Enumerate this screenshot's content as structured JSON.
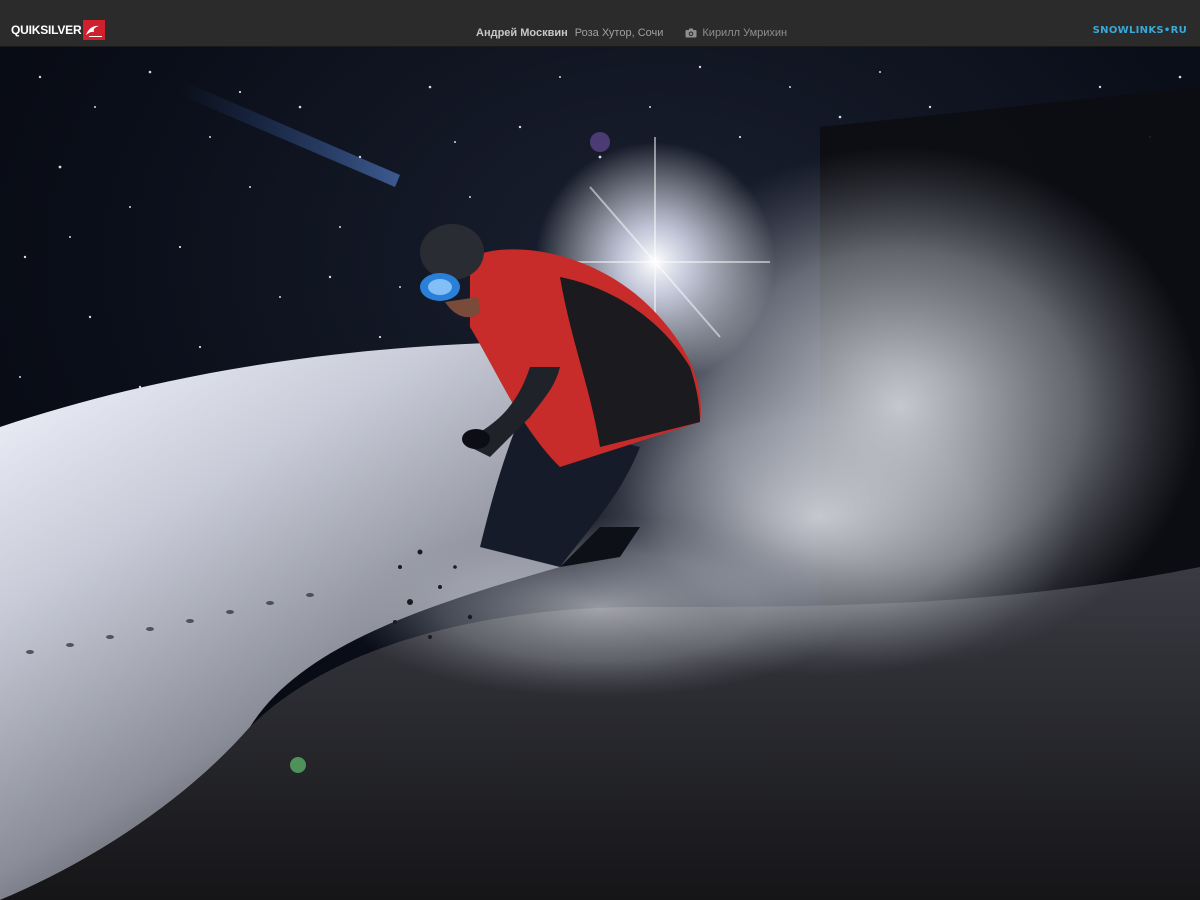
{
  "header": {
    "brand": "QUIKSILVER",
    "author": "Андрей Москвин",
    "location": "Роза Хутор, Сочи",
    "photographer": "Кирилл Умрихин",
    "site_link": "SNOWLINKS•RU"
  },
  "icons": {
    "brand_logo": "quiksilver-wave-logo",
    "camera": "camera-icon"
  },
  "colors": {
    "topbar": "#2b2b2b",
    "brand_red": "#d0202e",
    "link_blue": "#3aa9d8"
  },
  "photo": {
    "subject": "snowboarder-night-powder"
  }
}
